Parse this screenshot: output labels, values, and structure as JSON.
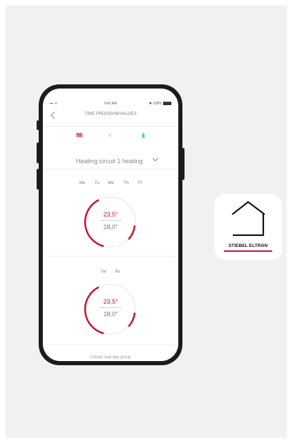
{
  "status_bar": {
    "signal": "▪▪▪ ᯤ",
    "time": "9:41 AM",
    "battery": "✱ 100%"
  },
  "nav": {
    "title": "TIME PROGRAM/VALUES",
    "back_icon": "chevron-left-icon"
  },
  "modes": [
    {
      "icon": "heating-icon",
      "glyph": "§§§",
      "active": true
    },
    {
      "icon": "cooling-icon",
      "glyph": "❄",
      "active": false
    },
    {
      "icon": "water-drop-icon",
      "glyph": "💧",
      "active": false
    }
  ],
  "circuit": {
    "label": "Heating circuit 1 heating",
    "icon": "chevron-down-icon"
  },
  "groups": [
    {
      "days": [
        "Mo",
        "Tu",
        "We",
        "Th",
        "Fr"
      ],
      "high": "23,5°",
      "low": "18,0°"
    },
    {
      "days": [
        "Sa",
        "Su"
      ],
      "high": "23,5°",
      "low": "18,0°"
    }
  ],
  "create_label": "Create new day group",
  "app_icon": {
    "brand": "STIEBEL ELTRON",
    "icon": "house-outline-icon"
  },
  "colors": {
    "accent": "#c8102e",
    "panel": "#f1f1f1",
    "phone": "#1c1c1e"
  }
}
